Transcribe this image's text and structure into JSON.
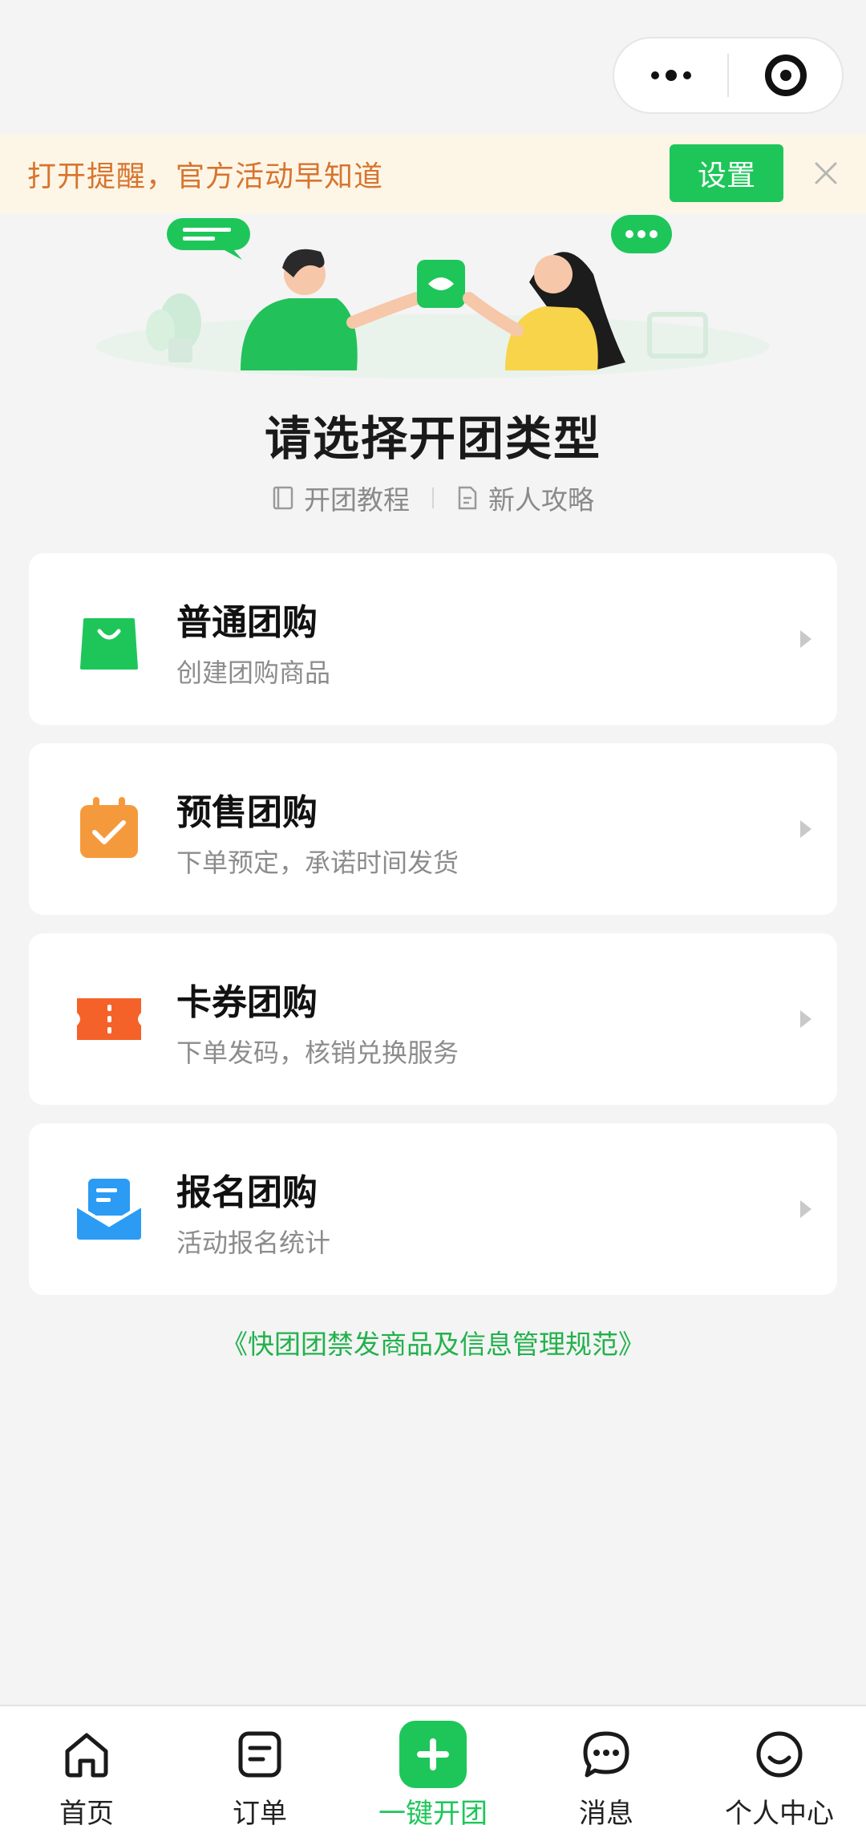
{
  "banner": {
    "text": "打开提醒，官方活动早知道",
    "button": "设置"
  },
  "page": {
    "title": "请选择开团类型",
    "links": [
      {
        "label": "开团教程",
        "icon": "book-icon"
      },
      {
        "label": "新人攻略",
        "icon": "document-icon"
      }
    ]
  },
  "cards": [
    {
      "title": "普通团购",
      "subtitle": "创建团购商品",
      "icon": "shopping-bag-icon",
      "color": "#1ec65a"
    },
    {
      "title": "预售团购",
      "subtitle": "下单预定，承诺时间发货",
      "icon": "calendar-check-icon",
      "color": "#f59a3c"
    },
    {
      "title": "卡券团购",
      "subtitle": "下单发码，核销兑换服务",
      "icon": "ticket-icon",
      "color": "#f4622a"
    },
    {
      "title": "报名团购",
      "subtitle": "活动报名统计",
      "icon": "mail-tray-icon",
      "color": "#2b9bf4"
    }
  ],
  "rules_link": "《快团团禁发商品及信息管理规范》",
  "tabbar": {
    "items": [
      {
        "label": "首页",
        "icon": "home-icon"
      },
      {
        "label": "订单",
        "icon": "order-icon"
      },
      {
        "label": "一键开团",
        "icon": "plus-icon",
        "active": true
      },
      {
        "label": "消息",
        "icon": "message-icon"
      },
      {
        "label": "个人中心",
        "icon": "profile-icon"
      }
    ]
  },
  "colors": {
    "accent": "#1ec65a",
    "banner_bg": "#fdf6e6",
    "banner_text": "#d8742f"
  }
}
